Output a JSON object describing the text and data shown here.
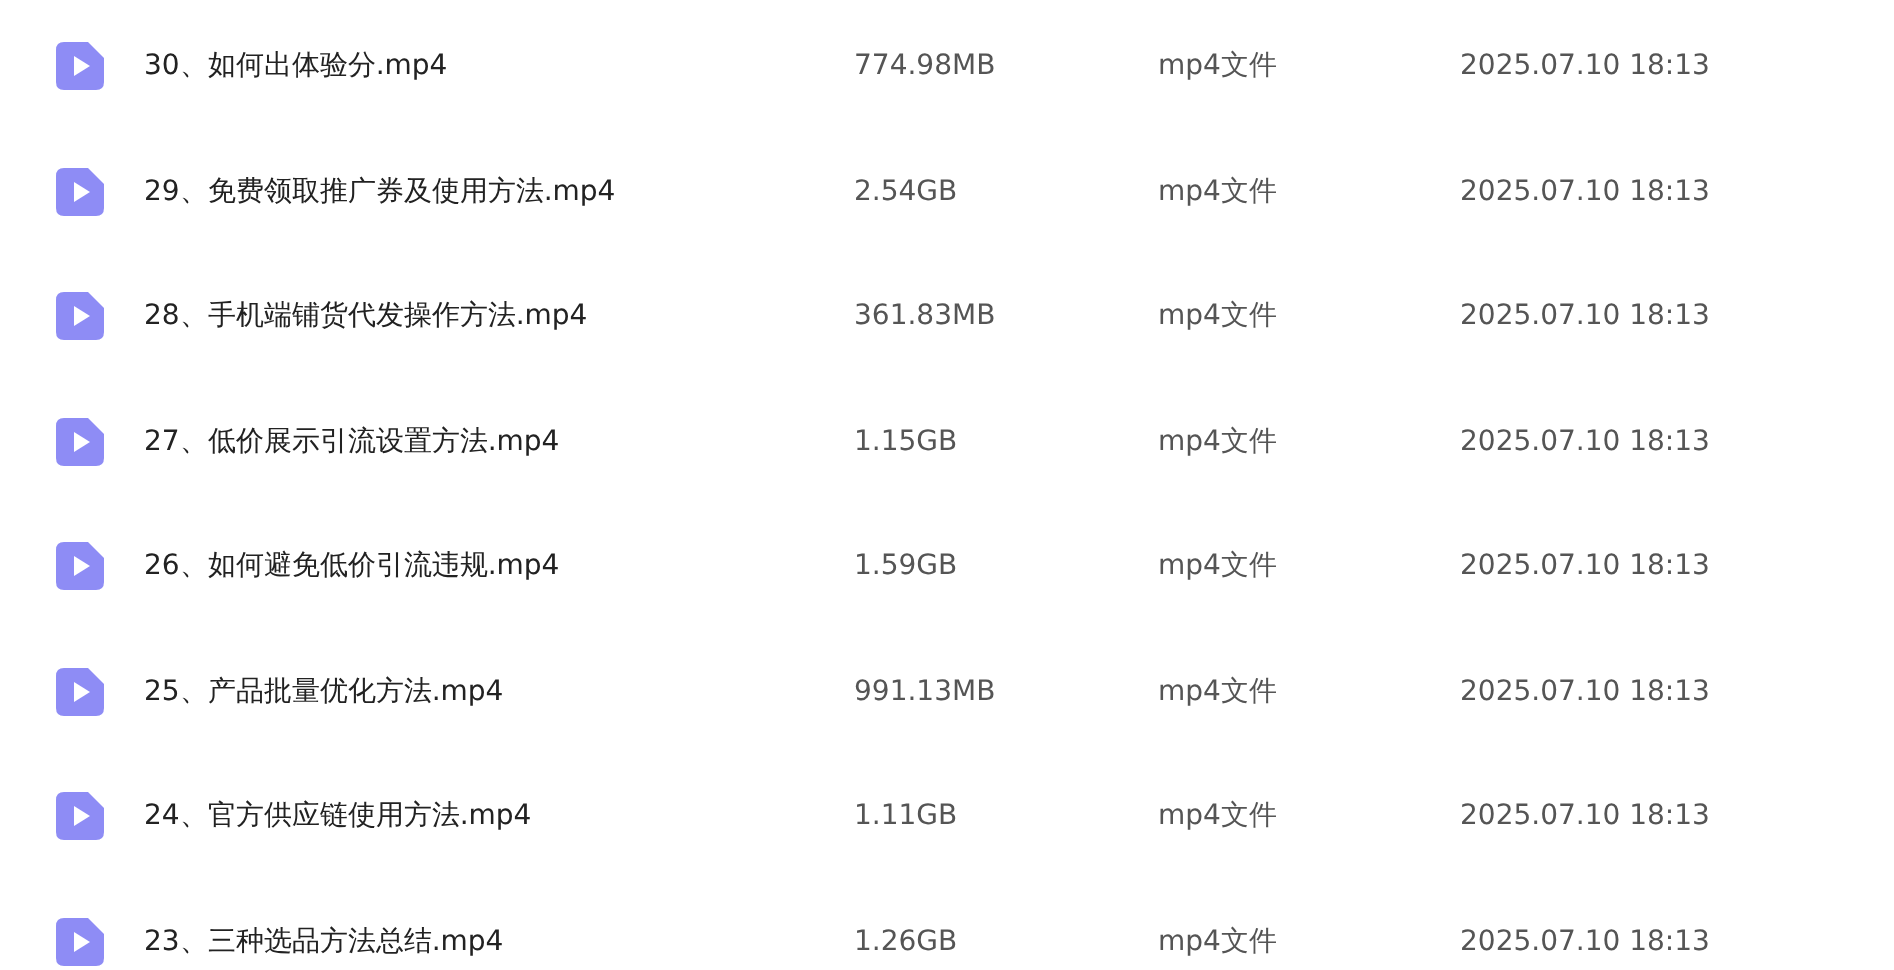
{
  "files": [
    {
      "name": "30、如何出体验分.mp4",
      "size": "774.98MB",
      "type": "mp4文件",
      "date": "2025.07.10 18:13"
    },
    {
      "name": "29、免费领取推广券及使用方法.mp4",
      "size": "2.54GB",
      "type": "mp4文件",
      "date": "2025.07.10 18:13"
    },
    {
      "name": "28、手机端铺货代发操作方法.mp4",
      "size": "361.83MB",
      "type": "mp4文件",
      "date": "2025.07.10 18:13"
    },
    {
      "name": "27、低价展示引流设置方法.mp4",
      "size": "1.15GB",
      "type": "mp4文件",
      "date": "2025.07.10 18:13"
    },
    {
      "name": "26、如何避免低价引流违规.mp4",
      "size": "1.59GB",
      "type": "mp4文件",
      "date": "2025.07.10 18:13"
    },
    {
      "name": "25、产品批量优化方法.mp4",
      "size": "991.13MB",
      "type": "mp4文件",
      "date": "2025.07.10 18:13"
    },
    {
      "name": "24、官方供应链使用方法.mp4",
      "size": "1.11GB",
      "type": "mp4文件",
      "date": "2025.07.10 18:13"
    },
    {
      "name": "23、三种选品方法总结.mp4",
      "size": "1.26GB",
      "type": "mp4文件",
      "date": "2025.07.10 18:13"
    }
  ]
}
